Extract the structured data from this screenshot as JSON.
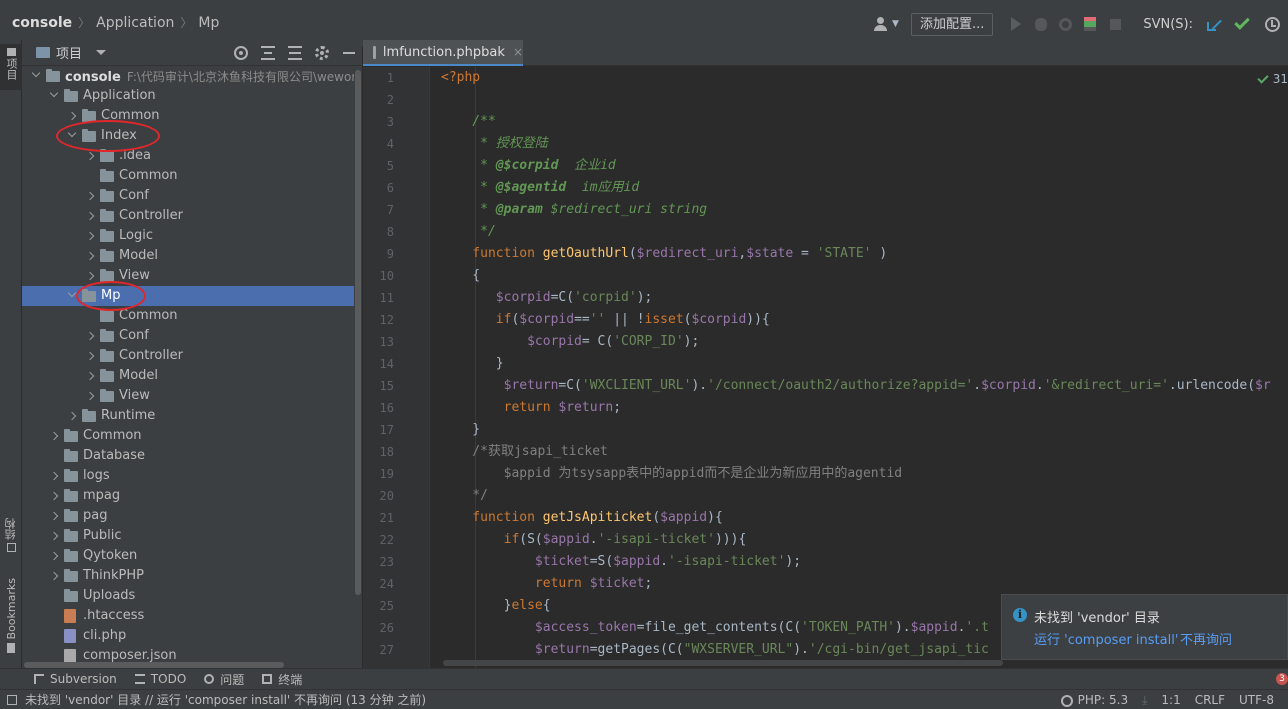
{
  "navbar": {
    "breadcrumb": [
      "console",
      "Application",
      "Mp"
    ],
    "add_config_label": "添加配置...",
    "svn_label": "SVN(S):"
  },
  "left_strip": {
    "project_tab": "项目",
    "structure_tab": "结构",
    "bookmarks_tab": "Bookmarks"
  },
  "project_panel": {
    "title": "项目",
    "root": {
      "name": "console",
      "path": "F:\\代码审计\\北京沐鱼科技有限公司\\wework-"
    },
    "tree": [
      {
        "label": "Application",
        "depth": 1,
        "arrow": "down",
        "type": "folder"
      },
      {
        "label": "Common",
        "depth": 2,
        "arrow": "right",
        "type": "folder"
      },
      {
        "label": "Index",
        "depth": 2,
        "arrow": "down",
        "type": "folder"
      },
      {
        "label": ".idea",
        "depth": 3,
        "arrow": "right",
        "type": "folder"
      },
      {
        "label": "Common",
        "depth": 3,
        "arrow": "none",
        "type": "folder"
      },
      {
        "label": "Conf",
        "depth": 3,
        "arrow": "right",
        "type": "folder"
      },
      {
        "label": "Controller",
        "depth": 3,
        "arrow": "right",
        "type": "folder"
      },
      {
        "label": "Logic",
        "depth": 3,
        "arrow": "right",
        "type": "folder"
      },
      {
        "label": "Model",
        "depth": 3,
        "arrow": "right",
        "type": "folder"
      },
      {
        "label": "View",
        "depth": 3,
        "arrow": "right",
        "type": "folder"
      },
      {
        "label": "Mp",
        "depth": 2,
        "arrow": "down",
        "type": "folder",
        "selected": true
      },
      {
        "label": "Common",
        "depth": 3,
        "arrow": "none",
        "type": "folder"
      },
      {
        "label": "Conf",
        "depth": 3,
        "arrow": "right",
        "type": "folder"
      },
      {
        "label": "Controller",
        "depth": 3,
        "arrow": "right",
        "type": "folder"
      },
      {
        "label": "Model",
        "depth": 3,
        "arrow": "right",
        "type": "folder"
      },
      {
        "label": "View",
        "depth": 3,
        "arrow": "right",
        "type": "folder"
      },
      {
        "label": "Runtime",
        "depth": 2,
        "arrow": "right",
        "type": "folder"
      },
      {
        "label": "Common",
        "depth": 1,
        "arrow": "right",
        "type": "folder"
      },
      {
        "label": "Database",
        "depth": 1,
        "arrow": "none",
        "type": "folder"
      },
      {
        "label": "logs",
        "depth": 1,
        "arrow": "right",
        "type": "folder"
      },
      {
        "label": "mpag",
        "depth": 1,
        "arrow": "right",
        "type": "folder"
      },
      {
        "label": "pag",
        "depth": 1,
        "arrow": "right",
        "type": "folder"
      },
      {
        "label": "Public",
        "depth": 1,
        "arrow": "right",
        "type": "folder"
      },
      {
        "label": "Qytoken",
        "depth": 1,
        "arrow": "right",
        "type": "folder"
      },
      {
        "label": "ThinkPHP",
        "depth": 1,
        "arrow": "right",
        "type": "folder"
      },
      {
        "label": "Uploads",
        "depth": 1,
        "arrow": "none",
        "type": "folder"
      },
      {
        "label": ".htaccess",
        "depth": 1,
        "arrow": "none",
        "type": "htaccess"
      },
      {
        "label": "cli.php",
        "depth": 1,
        "arrow": "none",
        "type": "php"
      },
      {
        "label": "composer.json",
        "depth": 1,
        "arrow": "none",
        "type": "json"
      }
    ]
  },
  "editor": {
    "tab_label": "lmfunction.phpbak",
    "tab_close": "×",
    "inspection_count": "31",
    "line_numbers": [
      "1",
      "2",
      "3",
      "4",
      "5",
      "6",
      "7",
      "8",
      "9",
      "10",
      "11",
      "12",
      "13",
      "14",
      "15",
      "16",
      "17",
      "18",
      "19",
      "20",
      "21",
      "22",
      "23",
      "24",
      "25",
      "26",
      "27"
    ],
    "code_lines": [
      [
        [
          "tag",
          "<?php"
        ]
      ],
      [],
      [
        [
          "doc",
          "    /**"
        ]
      ],
      [
        [
          "doc",
          "     * 授权登陆"
        ]
      ],
      [
        [
          "doc",
          "     * "
        ],
        [
          "doctag",
          "@$corpid"
        ],
        [
          "doc",
          "  企业id"
        ]
      ],
      [
        [
          "doc",
          "     * "
        ],
        [
          "doctag",
          "@$agentid"
        ],
        [
          "doc",
          "  im应用id"
        ]
      ],
      [
        [
          "doc",
          "     * "
        ],
        [
          "doctag",
          "@param"
        ],
        [
          "doc",
          " $redirect_uri string"
        ]
      ],
      [
        [
          "doc",
          "     */"
        ]
      ],
      [
        [
          "kw",
          "    function "
        ],
        [
          "fn",
          "getOauthUrl"
        ],
        [
          "plain",
          "("
        ],
        [
          "var",
          "$redirect_uri"
        ],
        [
          "plain",
          ","
        ],
        [
          "var",
          "$state"
        ],
        [
          "plain",
          " = "
        ],
        [
          "str",
          "'STATE'"
        ],
        [
          "plain",
          " )"
        ]
      ],
      [
        [
          "plain",
          "    {"
        ]
      ],
      [
        [
          "var",
          "       $corpid"
        ],
        [
          "plain",
          "=C("
        ],
        [
          "str",
          "'corpid'"
        ],
        [
          "plain",
          ");"
        ]
      ],
      [
        [
          "kw",
          "       if"
        ],
        [
          "plain",
          "("
        ],
        [
          "var",
          "$corpid"
        ],
        [
          "plain",
          "=="
        ],
        [
          "str",
          "''"
        ],
        [
          "plain",
          " || !"
        ],
        [
          "kw",
          "isset"
        ],
        [
          "plain",
          "("
        ],
        [
          "var",
          "$corpid"
        ],
        [
          "plain",
          ")){"
        ]
      ],
      [
        [
          "var",
          "           $corpid"
        ],
        [
          "plain",
          "= C("
        ],
        [
          "str",
          "'CORP_ID'"
        ],
        [
          "plain",
          ");"
        ]
      ],
      [
        [
          "plain",
          "       }"
        ]
      ],
      [
        [
          "var",
          "        $return"
        ],
        [
          "plain",
          "=C("
        ],
        [
          "str",
          "'WXCLIENT_URL'"
        ],
        [
          "plain",
          ")."
        ],
        [
          "str",
          "'/connect/oauth2/authorize?appid='"
        ],
        [
          "plain",
          "."
        ],
        [
          "var",
          "$corpid"
        ],
        [
          "plain",
          "."
        ],
        [
          "str",
          "'&redirect_uri='"
        ],
        [
          "plain",
          ".urlencode("
        ],
        [
          "var",
          "$r"
        ]
      ],
      [
        [
          "kw",
          "        return "
        ],
        [
          "var",
          "$return"
        ],
        [
          "plain",
          ";"
        ]
      ],
      [
        [
          "plain",
          "    }"
        ]
      ],
      [
        [
          "cm",
          "    /*获取jsapi_ticket"
        ]
      ],
      [
        [
          "cm",
          "        $appid 为tsysapp表中的appid而不是企业为新应用中的agentid"
        ]
      ],
      [
        [
          "cm",
          "    */"
        ]
      ],
      [
        [
          "kw",
          "    function "
        ],
        [
          "fn",
          "getJsApiticket"
        ],
        [
          "plain",
          "("
        ],
        [
          "var",
          "$appid"
        ],
        [
          "plain",
          "){"
        ]
      ],
      [
        [
          "kw",
          "        if"
        ],
        [
          "plain",
          "(S("
        ],
        [
          "var",
          "$appid"
        ],
        [
          "plain",
          "."
        ],
        [
          "str",
          "'-isapi-ticket'"
        ],
        [
          "plain",
          "))){"
        ]
      ],
      [
        [
          "var",
          "            $ticket"
        ],
        [
          "plain",
          "=S("
        ],
        [
          "var",
          "$appid"
        ],
        [
          "plain",
          "."
        ],
        [
          "str",
          "'-isapi-ticket'"
        ],
        [
          "plain",
          ");"
        ]
      ],
      [
        [
          "kw",
          "            return "
        ],
        [
          "var",
          "$ticket"
        ],
        [
          "plain",
          ";"
        ]
      ],
      [
        [
          "plain",
          "        }"
        ],
        [
          "kw",
          "else"
        ],
        [
          "plain",
          "{"
        ]
      ],
      [
        [
          "var",
          "            $access_token"
        ],
        [
          "plain",
          "=file_get_contents(C("
        ],
        [
          "str",
          "'TOKEN_PATH'"
        ],
        [
          "plain",
          ")."
        ],
        [
          "var",
          "$appid"
        ],
        [
          "plain",
          "."
        ],
        [
          "str",
          "'.t"
        ]
      ],
      [
        [
          "var",
          "            $return"
        ],
        [
          "plain",
          "=getPages(C("
        ],
        [
          "str",
          "\"WXSERVER_URL\""
        ],
        [
          "plain",
          ")."
        ],
        [
          "str",
          "'/cgi-bin/get_jsapi_tic"
        ]
      ]
    ]
  },
  "notification": {
    "message": "未找到 'vendor' 目录",
    "action_install": "运行 'composer install'",
    "action_dismiss": "不再询问"
  },
  "bottom_tools": [
    {
      "name": "subversion",
      "label": "Subversion"
    },
    {
      "name": "todo",
      "label": "TODO"
    },
    {
      "name": "problems",
      "label": "问题"
    },
    {
      "name": "terminal",
      "label": "终端"
    }
  ],
  "bottom_error_count": "3",
  "status_bar": {
    "message": "未找到 'vendor' 目录 // 运行 'composer install'   不再询问 (13 分钟 之前)",
    "php_version": "PHP: 5.3",
    "position": "1:1",
    "line_sep": "CRLF",
    "encoding": "UTF-8"
  },
  "colors": {
    "background": "#2b2b2b",
    "panel": "#3c3f41",
    "selection": "#4b6eaf",
    "annotation_circle": "#e0272c"
  }
}
